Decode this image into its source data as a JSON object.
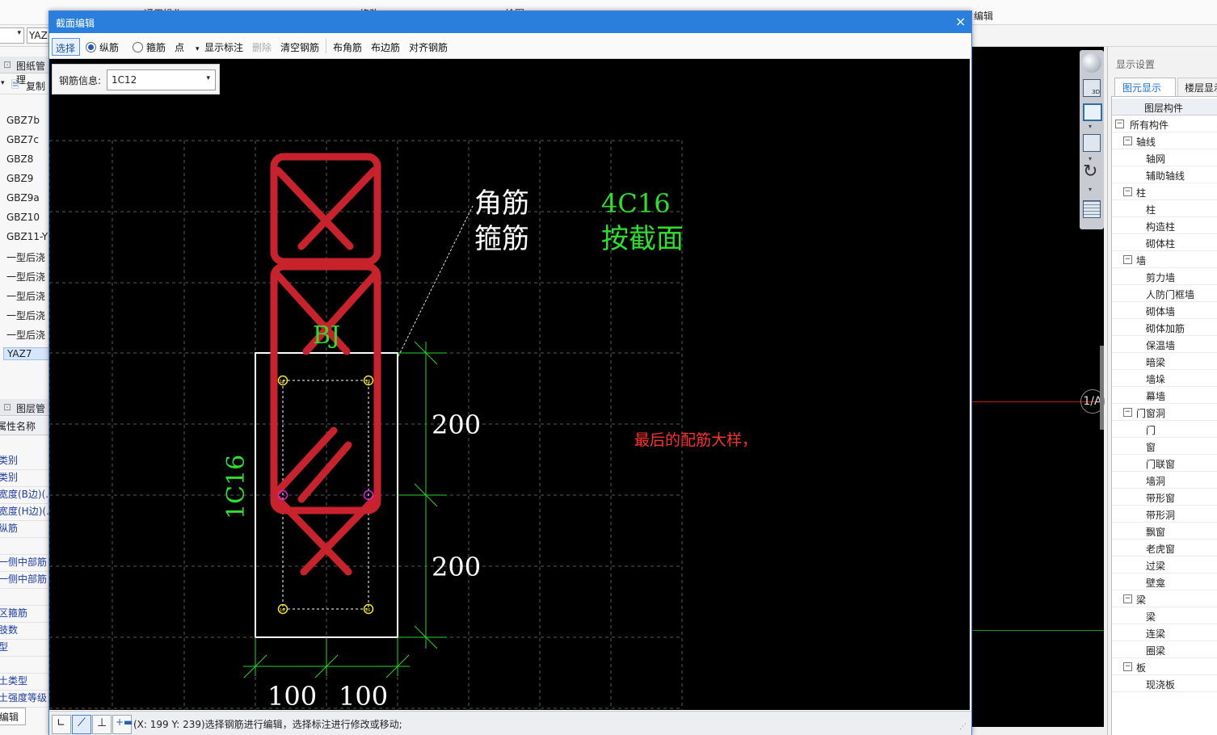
{
  "background_app": {
    "top_tabs": [
      "通用操作",
      "修改",
      "绘图",
      "编辑"
    ],
    "combo_left_value": "YAZ",
    "left_panel": {
      "drawing_panel_title": "图纸管理",
      "copy_label": "复制",
      "components": [
        "GBZ7b",
        "GBZ7c",
        "GBZ8",
        "GBZ9",
        "GBZ9a",
        "GBZ10",
        "GBZ11-Y",
        "一型后浇",
        "一型后浇",
        "一型后浇",
        "一型后浇",
        "一型后浇",
        "YAZ7"
      ],
      "selected_component": "YAZ7",
      "layer_panel_title": "图层管理",
      "property_header": "属性名称",
      "properties": [
        "类别",
        "类别",
        "宽度(B边)(...",
        "宽度(H边)(...",
        "纵筋",
        "",
        "一侧中部筋",
        "一侧中部筋",
        "",
        "区箍筋",
        "肢数",
        "型",
        "",
        "土类型",
        "土强度等级"
      ],
      "edit_button": "编辑"
    },
    "canvas_axis_label": "1/A",
    "display_panel": {
      "title": "显示设置",
      "tabs": [
        "图元显示",
        "楼层显示"
      ],
      "column_header": "图层构件",
      "tree": [
        {
          "level": 0,
          "label": "所有构件",
          "expand": true
        },
        {
          "level": 1,
          "label": "轴线",
          "expand": true
        },
        {
          "level": 2,
          "label": "轴网"
        },
        {
          "level": 2,
          "label": "辅助轴线"
        },
        {
          "level": 1,
          "label": "柱",
          "expand": true
        },
        {
          "level": 2,
          "label": "柱"
        },
        {
          "level": 2,
          "label": "构造柱"
        },
        {
          "level": 2,
          "label": "砌体柱"
        },
        {
          "level": 1,
          "label": "墙",
          "expand": true
        },
        {
          "level": 2,
          "label": "剪力墙"
        },
        {
          "level": 2,
          "label": "人防门框墙"
        },
        {
          "level": 2,
          "label": "砌体墙"
        },
        {
          "level": 2,
          "label": "砌体加筋"
        },
        {
          "level": 2,
          "label": "保温墙"
        },
        {
          "level": 2,
          "label": "暗梁"
        },
        {
          "level": 2,
          "label": "墙垛"
        },
        {
          "level": 2,
          "label": "幕墙"
        },
        {
          "level": 1,
          "label": "门窗洞",
          "expand": true
        },
        {
          "level": 2,
          "label": "门"
        },
        {
          "level": 2,
          "label": "窗"
        },
        {
          "level": 2,
          "label": "门联窗"
        },
        {
          "level": 2,
          "label": "墙洞"
        },
        {
          "level": 2,
          "label": "带形窗"
        },
        {
          "level": 2,
          "label": "带形洞"
        },
        {
          "level": 2,
          "label": "飘窗"
        },
        {
          "level": 2,
          "label": "老虎窗"
        },
        {
          "level": 2,
          "label": "过梁"
        },
        {
          "level": 2,
          "label": "壁龛"
        },
        {
          "level": 1,
          "label": "梁",
          "expand": true
        },
        {
          "level": 2,
          "label": "梁"
        },
        {
          "level": 2,
          "label": "连梁"
        },
        {
          "level": 2,
          "label": "圈梁"
        },
        {
          "level": 1,
          "label": "板",
          "expand": true
        },
        {
          "level": 2,
          "label": "现浇板"
        }
      ]
    }
  },
  "dialog": {
    "title": "截面编辑",
    "close_glyph": "×",
    "toolbar": {
      "select": "选择",
      "longitudinal": "纵筋",
      "stirrup": "箍筋",
      "mode": "点",
      "show_label": "显示标注",
      "delete": "删除",
      "clear": "清空钢筋",
      "corner": "布角筋",
      "edge": "布边筋",
      "align": "对齐钢筋"
    },
    "rebar_info_label": "钢筋信息:",
    "rebar_info_value": "1C12",
    "drawing": {
      "corner_label": "角筋",
      "stirrup_label": "箍筋",
      "corner_value": "4C16",
      "stirrup_value": "按截面",
      "bj_label": "BJ",
      "side_label": "1C16",
      "dim_right_top": "200",
      "dim_right_bottom": "200",
      "dim_bottom_left": "100",
      "dim_bottom_right": "100",
      "annotation": "最后的配筋大样，",
      "bar_tag": "16"
    },
    "status_text": "(X: 199 Y: 239)选择钢筋进行编辑，选择标注进行修改或移动;"
  },
  "colors": {
    "dialog_title": "#2b7fdc",
    "rebar": "#c8232c",
    "dimension": "#25d52b",
    "label_green": "#2ee02e",
    "annotation_red": "#ff3030"
  }
}
